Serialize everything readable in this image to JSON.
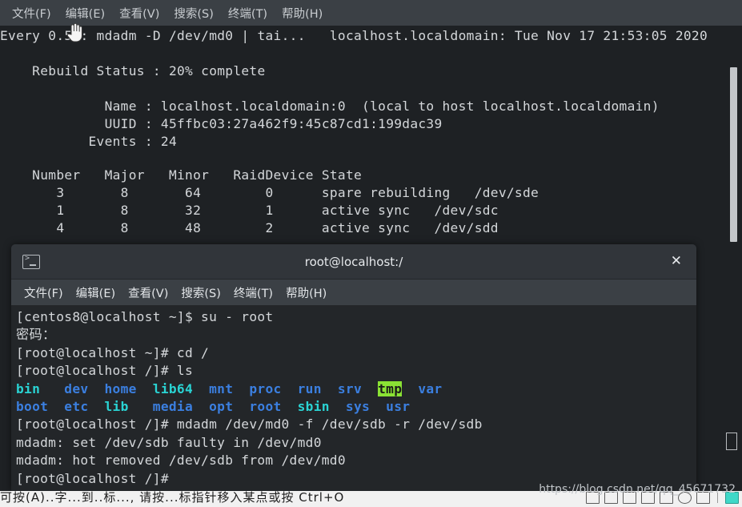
{
  "outer_window": {
    "menu": [
      {
        "label": "文件(F)",
        "name": "file"
      },
      {
        "label": "编辑(E)",
        "name": "edit"
      },
      {
        "label": "查看(V)",
        "name": "view"
      },
      {
        "label": "搜索(S)",
        "name": "search"
      },
      {
        "label": "终端(T)",
        "name": "terminal"
      },
      {
        "label": "帮助(H)",
        "name": "help"
      }
    ],
    "lines": [
      "Every 0.5s: mdadm -D /dev/md0 | tai...   localhost.localdomain: Tue Nov 17 21:53:05 2020",
      "",
      "    Rebuild Status : 20% complete",
      "",
      "             Name : localhost.localdomain:0  (local to host localhost.localdomain)",
      "             UUID : 45ffbc03:27a462f9:45c87cd1:199dac39",
      "           Events : 24",
      "",
      "    Number   Major   Minor   RaidDevice State",
      "       3       8       64        0      spare rebuilding   /dev/sde",
      "       1       8       32        1      active sync   /dev/sdc",
      "       4       8       48        2      active sync   /dev/sdd"
    ]
  },
  "inner_window": {
    "title": "root@localhost:/",
    "close_label": "✕",
    "menu": [
      {
        "label": "文件(F)",
        "name": "file"
      },
      {
        "label": "编辑(E)",
        "name": "edit"
      },
      {
        "label": "查看(V)",
        "name": "view"
      },
      {
        "label": "搜索(S)",
        "name": "search"
      },
      {
        "label": "终端(T)",
        "name": "terminal"
      },
      {
        "label": "帮助(H)",
        "name": "help"
      }
    ],
    "lines": [
      [
        {
          "t": "[centos8@localhost ~]$ su - root",
          "c": "default"
        }
      ],
      [
        {
          "t": "密码：",
          "c": "default"
        }
      ],
      [
        {
          "t": "[root@localhost ~]# cd /",
          "c": "default"
        }
      ],
      [
        {
          "t": "[root@localhost /]# ls",
          "c": "default"
        }
      ],
      [
        {
          "t": "bin",
          "c": "cyan"
        },
        {
          "t": "   ",
          "c": "default"
        },
        {
          "t": "dev",
          "c": "blue"
        },
        {
          "t": "  ",
          "c": "default"
        },
        {
          "t": "home",
          "c": "blue"
        },
        {
          "t": "  ",
          "c": "default"
        },
        {
          "t": "lib64",
          "c": "cyan"
        },
        {
          "t": "  ",
          "c": "default"
        },
        {
          "t": "mnt",
          "c": "blue"
        },
        {
          "t": "  ",
          "c": "default"
        },
        {
          "t": "proc",
          "c": "blue"
        },
        {
          "t": "  ",
          "c": "default"
        },
        {
          "t": "run",
          "c": "blue"
        },
        {
          "t": "  ",
          "c": "default"
        },
        {
          "t": "srv",
          "c": "blue"
        },
        {
          "t": "  ",
          "c": "default"
        },
        {
          "t": "tmp",
          "c": "green-bg"
        },
        {
          "t": "  ",
          "c": "default"
        },
        {
          "t": "var",
          "c": "blue"
        }
      ],
      [
        {
          "t": "boot",
          "c": "blue"
        },
        {
          "t": "  ",
          "c": "default"
        },
        {
          "t": "etc",
          "c": "blue"
        },
        {
          "t": "  ",
          "c": "default"
        },
        {
          "t": "lib",
          "c": "cyan"
        },
        {
          "t": "   ",
          "c": "default"
        },
        {
          "t": "media",
          "c": "blue"
        },
        {
          "t": "  ",
          "c": "default"
        },
        {
          "t": "opt",
          "c": "blue"
        },
        {
          "t": "  ",
          "c": "default"
        },
        {
          "t": "root",
          "c": "blue"
        },
        {
          "t": "  ",
          "c": "default"
        },
        {
          "t": "sbin",
          "c": "cyan"
        },
        {
          "t": "  ",
          "c": "default"
        },
        {
          "t": "sys",
          "c": "blue"
        },
        {
          "t": "  ",
          "c": "default"
        },
        {
          "t": "usr",
          "c": "blue"
        }
      ],
      [
        {
          "t": "[root@localhost /]# mdadm /dev/md0 -f /dev/sdb -r /dev/sdb",
          "c": "default"
        }
      ],
      [
        {
          "t": "mdadm: set /dev/sdb faulty in /dev/md0",
          "c": "default"
        }
      ],
      [
        {
          "t": "mdadm: hot removed /dev/sdb from /dev/md0",
          "c": "default"
        }
      ],
      [
        {
          "t": "[root@localhost /]#",
          "c": "default"
        }
      ]
    ]
  },
  "watermark": "https://blog.csdn.net/qq_45671732",
  "bottom_strip": {
    "cut_text": "可按(A)..字...到..标..., 请按...标指针移入某点或按 Ctrl+O"
  },
  "colors": {
    "terminal_bg": "#1e2124",
    "inner_bg": "#232629",
    "menubar_bg": "#3b4045",
    "titlebar_bg": "#31353a",
    "desktop_blue": "#0b1d45",
    "dir_cyan": "#2ad4d4",
    "dir_blue": "#3b7fe0",
    "tmp_green": "#8ae234",
    "text_fg": "#d4d7da"
  }
}
